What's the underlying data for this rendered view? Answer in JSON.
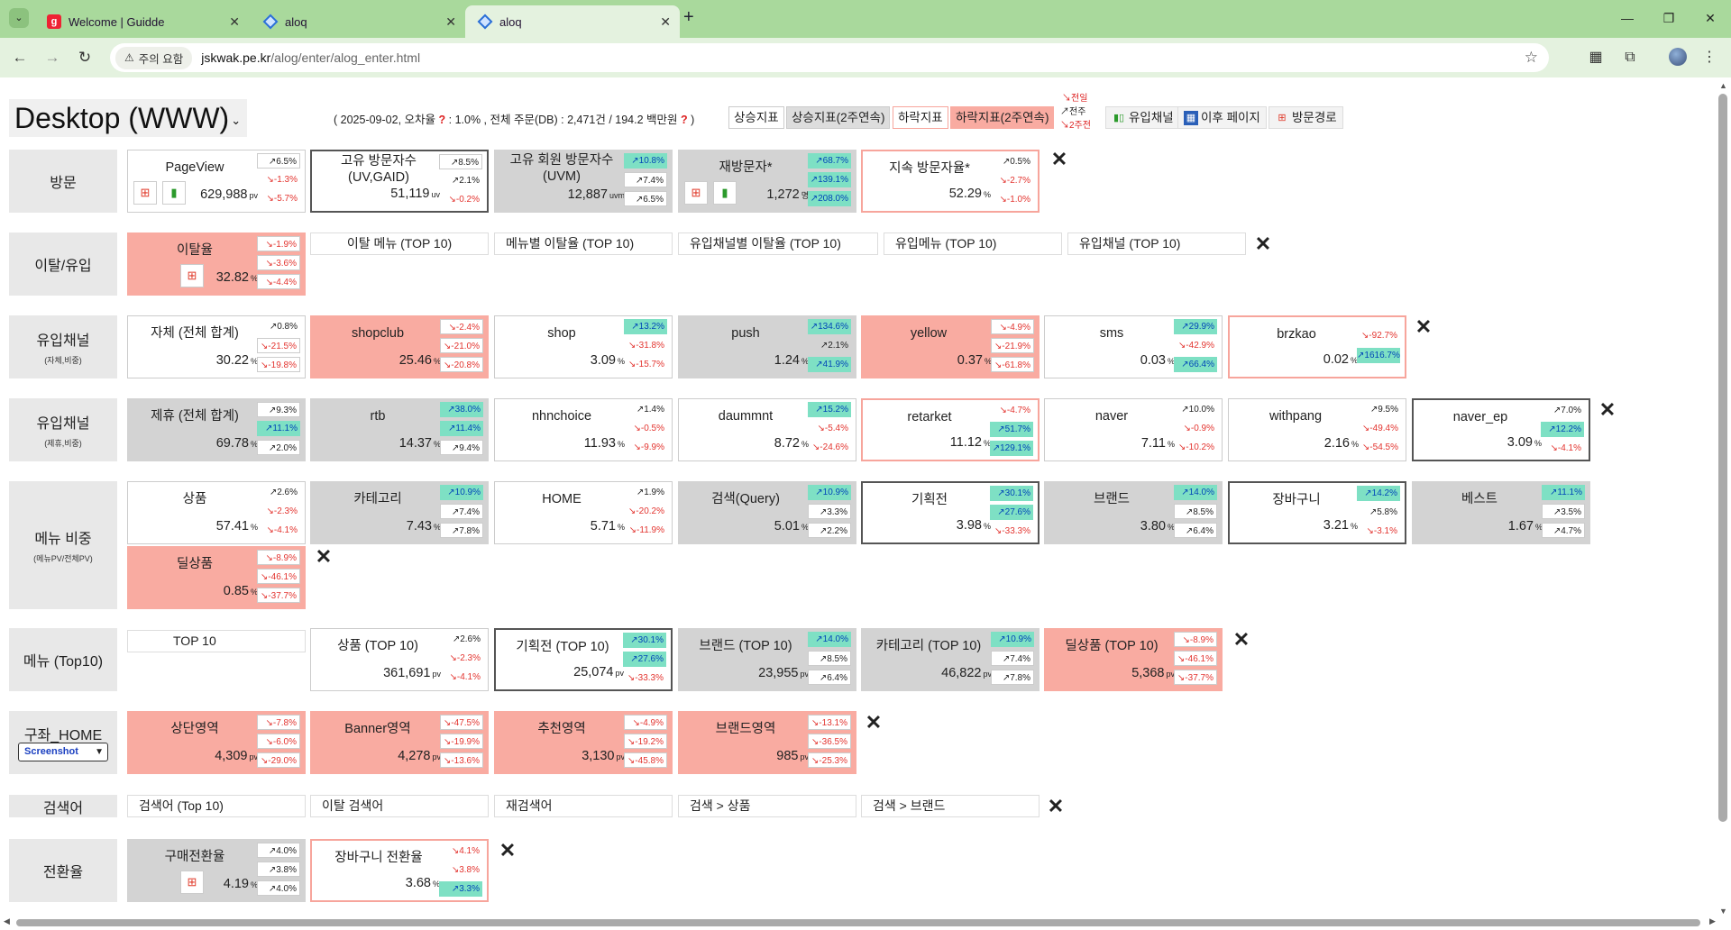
{
  "browser": {
    "tabs": [
      {
        "title": "Welcome | Guidde",
        "favicon": "g"
      },
      {
        "title": "aloq",
        "favicon": "diamond"
      },
      {
        "title": "aloq",
        "favicon": "diamond"
      }
    ],
    "new_tab": "+",
    "url_chip": "주의 요함",
    "url_host": "jskwak.pe.kr",
    "url_path": "/alog/enter/alog_enter.html"
  },
  "header": {
    "title": "Desktop (WWW)",
    "info_prefix": "( 2025-09-02, 오차율",
    "info_mid": ": 1.0% , 전체 주문(DB) : 2,471건 / 194.2 백만원",
    "info_suffix": ")",
    "q": "?",
    "filters": [
      "상승지표",
      "상승지표(2주연속)",
      "하락지표",
      "하락지표(2주연속)"
    ],
    "period": [
      "↘전일",
      "↗전주",
      "↘2주전"
    ],
    "panels": [
      "유입채널",
      "이후 페이지",
      "방문경로"
    ]
  },
  "rows": {
    "visit": {
      "label": "방문",
      "cards": [
        {
          "name": "PageView",
          "value": "629,988",
          "unit": "pv",
          "chg": [
            "↗6.5%",
            "↘-1.3%",
            "↘-5.7%"
          ]
        },
        {
          "name": "고유 방문자수\n(UV,GAID)",
          "value": "51,119",
          "unit": "uv",
          "chg": [
            "↗8.5%",
            "↗2.1%",
            "↘-0.2%"
          ]
        },
        {
          "name": "고유 회원 방문자수\n(UVM)",
          "value": "12,887",
          "unit": "uvm",
          "chg": [
            "↗10.8%",
            "↗7.4%",
            "↗6.5%"
          ]
        },
        {
          "name": "재방문자*",
          "value": "1,272",
          "unit": "명",
          "chg": [
            "↗68.7%",
            "↗139.1%",
            "↗208.0%"
          ]
        },
        {
          "name": "지속 방문자율*",
          "value": "52.29",
          "unit": "%",
          "chg": [
            "↗0.5%",
            "↘-2.7%",
            "↘-1.0%"
          ]
        }
      ]
    },
    "bounce": {
      "label": "이탈/유입",
      "card": {
        "name": "이탈율",
        "value": "32.82",
        "unit": "%",
        "chg": [
          "↘-1.9%",
          "↘-3.6%",
          "↘-4.4%"
        ]
      },
      "links": [
        "이탈 메뉴 (TOP 10)",
        "메뉴별 이탈율 (TOP 10)",
        "유입채널별 이탈율 (TOP 10)",
        "유입메뉴 (TOP 10)",
        "유입채널 (TOP 10)"
      ]
    },
    "ch_self": {
      "label": "유입채널",
      "sub": "(자체,비중)",
      "cards": [
        {
          "name": "자체 (전체 합계)",
          "value": "30.22",
          "unit": "%",
          "chg": [
            "↗0.8%",
            "↘-21.5%",
            "↘-19.8%"
          ]
        },
        {
          "name": "shopclub",
          "value": "25.46",
          "unit": "%",
          "chg": [
            "↘-2.4%",
            "↘-21.0%",
            "↘-20.8%"
          ]
        },
        {
          "name": "shop",
          "value": "3.09",
          "unit": "%",
          "chg": [
            "↗13.2%",
            "↘-31.8%",
            "↘-15.7%"
          ]
        },
        {
          "name": "push",
          "value": "1.24",
          "unit": "%",
          "chg": [
            "↗134.6%",
            "↗2.1%",
            "↗41.9%"
          ]
        },
        {
          "name": "yellow",
          "value": "0.37",
          "unit": "%",
          "chg": [
            "↘-4.9%",
            "↘-21.9%",
            "↘-61.8%"
          ]
        },
        {
          "name": "sms",
          "value": "0.03",
          "unit": "%",
          "chg": [
            "↗29.9%",
            "↘-42.9%",
            "↗66.4%"
          ]
        },
        {
          "name": "brzkao",
          "value": "0.02",
          "unit": "%",
          "chg": [
            "↘-92.7%",
            "↗1616.7%"
          ]
        }
      ]
    },
    "ch_partner": {
      "label": "유입채널",
      "sub": "(제휴,비중)",
      "cards": [
        {
          "name": "제휴 (전체 합계)",
          "value": "69.78",
          "unit": "%",
          "chg": [
            "↗9.3%",
            "↗11.1%",
            "↗2.0%"
          ]
        },
        {
          "name": "rtb",
          "value": "14.37",
          "unit": "%",
          "chg": [
            "↗38.0%",
            "↗11.4%",
            "↗9.4%"
          ]
        },
        {
          "name": "nhnchoice",
          "value": "11.93",
          "unit": "%",
          "chg": [
            "↗1.4%",
            "↘-0.5%",
            "↘-9.9%"
          ]
        },
        {
          "name": "daummnt",
          "value": "8.72",
          "unit": "%",
          "chg": [
            "↗15.2%",
            "↘-5.4%",
            "↘-24.6%"
          ]
        },
        {
          "name": "retarket",
          "value": "11.12",
          "unit": "%",
          "chg": [
            "↘-4.7%",
            "↗51.7%",
            "↗129.1%"
          ]
        },
        {
          "name": "naver",
          "value": "7.11",
          "unit": "%",
          "chg": [
            "↗10.0%",
            "↘-0.9%",
            "↘-10.2%"
          ]
        },
        {
          "name": "withpang",
          "value": "2.16",
          "unit": "%",
          "chg": [
            "↗9.5%",
            "↘-49.4%",
            "↘-54.5%"
          ]
        },
        {
          "name": "naver_ep",
          "value": "3.09",
          "unit": "%",
          "chg": [
            "↗7.0%",
            "↗12.2%",
            "↘-4.1%"
          ]
        }
      ]
    },
    "menu_share": {
      "label": "메뉴 비중",
      "sub": "(메뉴PV/전체PV)",
      "cards": [
        {
          "name": "상품",
          "value": "57.41",
          "unit": "%",
          "chg": [
            "↗2.6%",
            "↘-2.3%",
            "↘-4.1%"
          ]
        },
        {
          "name": "카테고리",
          "value": "7.43",
          "unit": "%",
          "chg": [
            "↗10.9%",
            "↗7.4%",
            "↗7.8%"
          ]
        },
        {
          "name": "HOME",
          "value": "5.71",
          "unit": "%",
          "chg": [
            "↗1.9%",
            "↘-20.2%",
            "↘-11.9%"
          ]
        },
        {
          "name": "검색(Query)",
          "value": "5.01",
          "unit": "%",
          "chg": [
            "↗10.9%",
            "↗3.3%",
            "↗2.2%"
          ]
        },
        {
          "name": "기획전",
          "value": "3.98",
          "unit": "%",
          "chg": [
            "↗30.1%",
            "↗27.6%",
            "↘-33.3%"
          ]
        },
        {
          "name": "브랜드",
          "value": "3.80",
          "unit": "%",
          "chg": [
            "↗14.0%",
            "↗8.5%",
            "↗6.4%"
          ]
        },
        {
          "name": "장바구니",
          "value": "3.21",
          "unit": "%",
          "chg": [
            "↗14.2%",
            "↗5.8%",
            "↘-3.1%"
          ]
        },
        {
          "name": "베스트",
          "value": "1.67",
          "unit": "%",
          "chg": [
            "↗11.1%",
            "↗3.5%",
            "↗4.7%"
          ]
        },
        {
          "name": "딜상품",
          "value": "0.85",
          "unit": "%",
          "chg": [
            "↘-8.9%",
            "↘-46.1%",
            "↘-37.7%"
          ]
        }
      ]
    },
    "menu_top": {
      "label": "메뉴 (Top10)",
      "top": "TOP 10",
      "cards": [
        {
          "name": "상품 (TOP 10)",
          "value": "361,691",
          "unit": "pv",
          "chg": [
            "↗2.6%",
            "↘-2.3%",
            "↘-4.1%"
          ]
        },
        {
          "name": "기획전 (TOP 10)",
          "value": "25,074",
          "unit": "pv",
          "chg": [
            "↗30.1%",
            "↗27.6%",
            "↘-33.3%"
          ]
        },
        {
          "name": "브랜드 (TOP 10)",
          "value": "23,955",
          "unit": "pv",
          "chg": [
            "↗14.0%",
            "↗8.5%",
            "↗6.4%"
          ]
        },
        {
          "name": "카테고리 (TOP 10)",
          "value": "46,822",
          "unit": "pv",
          "chg": [
            "↗10.9%",
            "↗7.4%",
            "↗7.8%"
          ]
        },
        {
          "name": "딜상품 (TOP 10)",
          "value": "5,368",
          "unit": "pv",
          "chg": [
            "↘-8.9%",
            "↘-46.1%",
            "↘-37.7%"
          ]
        }
      ]
    },
    "home": {
      "label": "구좌_HOME",
      "select": "Screenshot",
      "cards": [
        {
          "name": "상단영역",
          "value": "4,309",
          "unit": "pv",
          "chg": [
            "↘-7.8%",
            "↘-6.0%",
            "↘-29.0%"
          ]
        },
        {
          "name": "Banner영역",
          "value": "4,278",
          "unit": "pv",
          "chg": [
            "↘-47.5%",
            "↘-19.9%",
            "↘-13.6%"
          ]
        },
        {
          "name": "추천영역",
          "value": "3,130",
          "unit": "pv",
          "chg": [
            "↘-4.9%",
            "↘-19.2%",
            "↘-45.8%"
          ]
        },
        {
          "name": "브랜드영역",
          "value": "985",
          "unit": "pv",
          "chg": [
            "↘-13.1%",
            "↘-36.5%",
            "↘-25.3%"
          ]
        }
      ]
    },
    "search": {
      "label": "검색어",
      "links": [
        "검색어 (Top 10)",
        "이탈 검색어",
        "재검색어",
        "검색 > 상품",
        "검색 > 브랜드"
      ]
    },
    "conversion": {
      "label": "전환율",
      "cards": [
        {
          "name": "구매전환율",
          "value": "4.19",
          "unit": "%",
          "chg": [
            "↗4.0%",
            "↗3.8%",
            "↗4.0%"
          ]
        },
        {
          "name": "장바구니 전환율",
          "value": "3.68",
          "unit": "%",
          "chg": [
            "↘4.1%",
            "↘3.8%",
            "↗3.3%"
          ]
        }
      ]
    }
  },
  "close_symbol": "✕",
  "colors": {
    "chrome": "#a9d99c",
    "red_card": "#f9aba1",
    "gray_card": "#d3d3d3",
    "green_badge": "#7ee0c4",
    "down_text": "#e3342f"
  }
}
